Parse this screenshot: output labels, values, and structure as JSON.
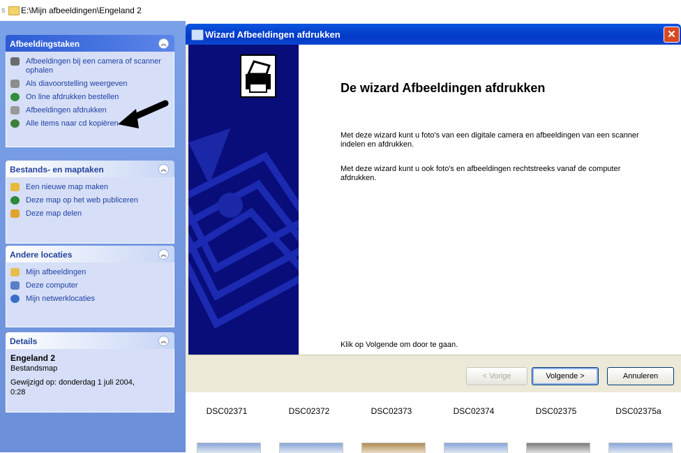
{
  "address_bar": {
    "lead": "s",
    "path": "E:\\Mijn afbeeldingen\\Engeland 2"
  },
  "task_pane": {
    "picture_tasks": {
      "title": "Afbeeldingstaken",
      "items": [
        {
          "label": "Afbeeldingen bij een camera of scanner ophalen",
          "icon": "camera-icon"
        },
        {
          "label": "Als diavoorstelling weergeven",
          "icon": "slideshow-icon"
        },
        {
          "label": "On line afdrukken bestellen",
          "icon": "globe-icon"
        },
        {
          "label": "Afbeeldingen afdrukken",
          "icon": "printer-icon"
        },
        {
          "label": "Alle items naar cd kopiëren",
          "icon": "cd-icon"
        }
      ]
    },
    "file_tasks": {
      "title": "Bestands- en maptaken",
      "items": [
        {
          "label": "Een nieuwe map maken",
          "icon": "new-folder-icon"
        },
        {
          "label": "Deze map op het web publiceren",
          "icon": "web-publish-icon"
        },
        {
          "label": "Deze map delen",
          "icon": "share-folder-icon"
        }
      ]
    },
    "other_places": {
      "title": "Andere locaties",
      "items": [
        {
          "label": "Mijn afbeeldingen",
          "icon": "my-pictures-icon"
        },
        {
          "label": "Deze computer",
          "icon": "computer-icon"
        },
        {
          "label": "Mijn netwerklocaties",
          "icon": "network-icon"
        }
      ]
    },
    "details": {
      "title": "Details",
      "name": "Engeland 2",
      "type": "Bestandsmap",
      "modified_line1": "Gewijzigd op: donderdag 1 juli 2004,",
      "modified_line2": "0:28"
    }
  },
  "wizard": {
    "title": "Wizard Afbeeldingen afdrukken",
    "close_label": "✕",
    "heading": "De wizard Afbeeldingen afdrukken",
    "para1": "Met deze wizard kunt u foto's van een digitale camera en afbeeldingen van een scanner indelen en afdrukken.",
    "para2": "Met deze wizard kunt u ook foto's en afbeeldingen rechtstreeks vanaf de computer afdrukken.",
    "footer_text": "Klik op Volgende om door te gaan.",
    "buttons": {
      "back": "< Vorige",
      "next": "Volgende >",
      "cancel": "Annuleren"
    }
  },
  "thumbnails": [
    "DSC02371",
    "DSC02372",
    "DSC02373",
    "DSC02374",
    "DSC02375",
    "DSC02375a"
  ],
  "colors": {
    "pane": "#6c8fd9",
    "wizard_side": "#080d7a",
    "title_bar": "#0339c6",
    "link": "#2140a4"
  }
}
